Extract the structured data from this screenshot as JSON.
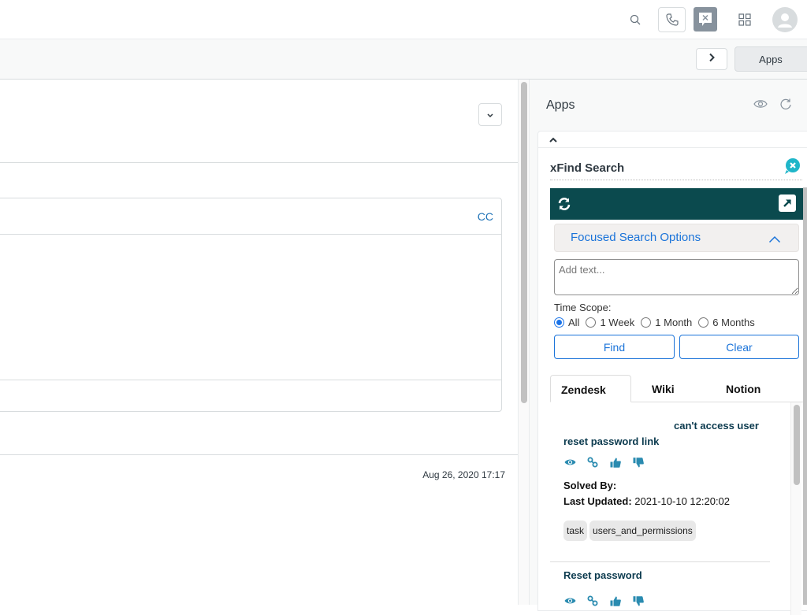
{
  "topbar": {
    "icons": [
      "search-icon",
      "phone-icon",
      "chat-dismiss-icon",
      "apps-grid-icon",
      "avatar-icon"
    ]
  },
  "subbar": {
    "next_icon": "chevron-right-icon",
    "apps_label": "Apps"
  },
  "main": {
    "cc_label": "CC",
    "timestamp": "Aug 26, 2020 17:17"
  },
  "apps_panel": {
    "title": "Apps",
    "icons": [
      "eye-icon",
      "refresh-icon"
    ],
    "app": {
      "name": "xFind Search",
      "focused_search_label": "Focused Search Options",
      "text_placeholder": "Add text...",
      "text_value": "",
      "time_scope_label": "Time Scope:",
      "time_scope_options": [
        {
          "label": "All",
          "selected": true
        },
        {
          "label": "1 Week",
          "selected": false
        },
        {
          "label": "1 Month",
          "selected": false
        },
        {
          "label": "6 Months",
          "selected": false
        }
      ],
      "find_label": "Find",
      "clear_label": "Clear",
      "tabs": [
        {
          "label": "Zendesk",
          "active": true
        },
        {
          "label": "Wiki",
          "active": false
        },
        {
          "label": "Notion",
          "active": false
        }
      ],
      "results": [
        {
          "title_line1": "can't access user",
          "title_line2": "reset password link",
          "actions": [
            "view-eye-icon",
            "link-icon",
            "thumbs-up-icon",
            "thumbs-down-icon"
          ],
          "solved_by_label": "Solved By:",
          "solved_by": "",
          "last_updated_label": "Last Updated:",
          "last_updated": "2021-10-10 12:20:02",
          "tags": [
            "task",
            "users_and_permissions"
          ]
        },
        {
          "title": "Reset password",
          "actions": [
            "view-eye-icon",
            "link-icon",
            "thumbs-up-icon",
            "thumbs-down-icon"
          ]
        }
      ]
    }
  },
  "colors": {
    "accent_blue": "#1a73d9",
    "xfind_bar": "#0b4a4e",
    "result_title": "#0b3a4e",
    "action_icons": "#2a8bb0",
    "xfind_logo": "#1fb6c9"
  }
}
